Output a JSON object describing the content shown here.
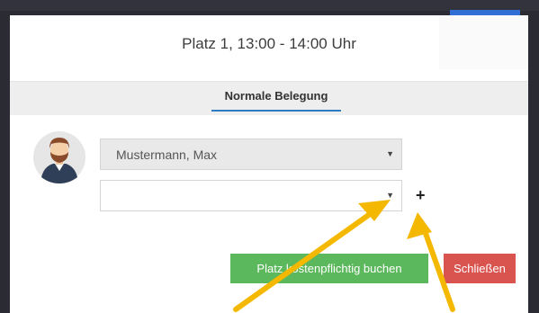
{
  "modal": {
    "title": "Platz 1, 13:00 - 14:00 Uhr"
  },
  "tabs": [
    {
      "label": "Normale Belegung",
      "active": true
    }
  ],
  "players": {
    "selected_player": "Mustermann, Max",
    "second_player": "",
    "add_icon": "plus-icon",
    "caret_icon": "caret-down-icon"
  },
  "buttons": {
    "book_label": "Platz kostenpflichtig buchen",
    "close_label": "Schließen"
  },
  "colors": {
    "accent": "#2f7bc4",
    "book": "#5cb85c",
    "close": "#d9534f",
    "annotation_arrow": "#f5b800"
  }
}
